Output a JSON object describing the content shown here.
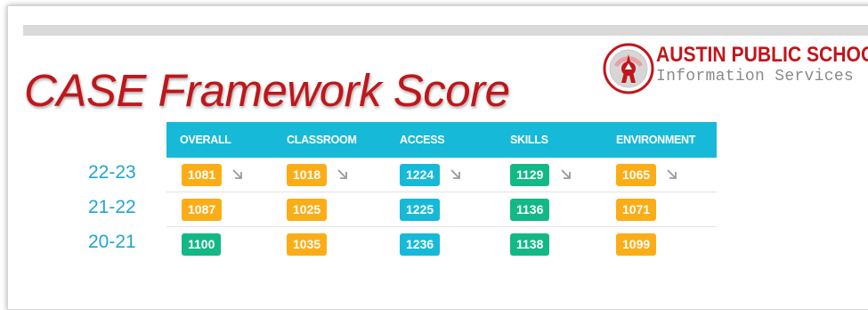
{
  "title": "CASE Framework Score",
  "logo": {
    "line1": "AUSTIN PUBLIC SCHOOLS",
    "line2": "Information Services",
    "icon": "aps-logo-icon",
    "colors": {
      "red": "#c0161b",
      "gray": "#8a8a8a"
    }
  },
  "table": {
    "headers": [
      "OVERALL",
      "CLASSROOM",
      "ACCESS",
      "SKILLS",
      "ENVIRONMENT"
    ],
    "header_color": "#17b9d8",
    "rows": [
      {
        "year": "22-23",
        "cells": [
          {
            "value": "1081",
            "color": "#fbad18",
            "trend": "down"
          },
          {
            "value": "1018",
            "color": "#fbad18",
            "trend": "down"
          },
          {
            "value": "1224",
            "color": "#17b9d8",
            "trend": "down"
          },
          {
            "value": "1129",
            "color": "#12b886",
            "trend": "down"
          },
          {
            "value": "1065",
            "color": "#fbad18",
            "trend": "down"
          }
        ]
      },
      {
        "year": "21-22",
        "cells": [
          {
            "value": "1087",
            "color": "#fbad18"
          },
          {
            "value": "1025",
            "color": "#fbad18"
          },
          {
            "value": "1225",
            "color": "#17b9d8"
          },
          {
            "value": "1136",
            "color": "#12b886"
          },
          {
            "value": "1071",
            "color": "#fbad18"
          }
        ]
      },
      {
        "year": "20-21",
        "cells": [
          {
            "value": "1100",
            "color": "#12b886"
          },
          {
            "value": "1035",
            "color": "#fbad18"
          },
          {
            "value": "1236",
            "color": "#17b9d8"
          },
          {
            "value": "1138",
            "color": "#12b886"
          },
          {
            "value": "1099",
            "color": "#fbad18"
          }
        ]
      }
    ]
  }
}
